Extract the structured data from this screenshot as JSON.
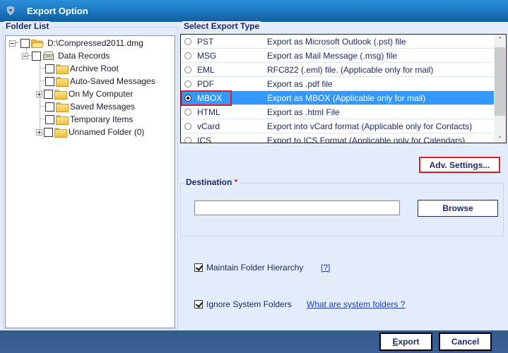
{
  "window": {
    "title": "Export Option",
    "icon": "app-logo-icon"
  },
  "folder_list": {
    "label": "Folder List",
    "tree": [
      {
        "label": "D:\\Compressed2011.dmg",
        "level": 0,
        "expander": "minus",
        "checked": false,
        "icon": "open-folder-icon"
      },
      {
        "label": "Data Records",
        "level": 1,
        "expander": "minus",
        "checked": false,
        "icon": "data-records-icon"
      },
      {
        "label": "Archive Root",
        "level": 2,
        "expander": null,
        "checked": false,
        "icon": "folder-icon"
      },
      {
        "label": "Auto-Saved Messages",
        "level": 2,
        "expander": null,
        "checked": false,
        "icon": "folder-icon"
      },
      {
        "label": "On My Computer",
        "level": 2,
        "expander": "plus",
        "checked": false,
        "icon": "folder-icon"
      },
      {
        "label": "Saved Messages",
        "level": 2,
        "expander": null,
        "checked": false,
        "icon": "folder-icon"
      },
      {
        "label": "Temporary Items",
        "level": 2,
        "expander": null,
        "checked": false,
        "icon": "folder-icon"
      },
      {
        "label": "Unnamed Folder (0)",
        "level": 2,
        "expander": "plus",
        "checked": false,
        "icon": "folder-icon"
      }
    ]
  },
  "export_type": {
    "label": "Select Export Type",
    "selected": "MBOX",
    "options": [
      {
        "name": "PST",
        "description": "Export as Microsoft Outlook (.pst) file"
      },
      {
        "name": "MSG",
        "description": "Export as Mail Message (.msg) file"
      },
      {
        "name": "EML",
        "description": "RFC822 (.eml) file. (Applicable only for mail)"
      },
      {
        "name": "PDF",
        "description": "Export as .pdf file"
      },
      {
        "name": "MBOX",
        "description": "Export as MBOX (Applicable only for mail)"
      },
      {
        "name": "HTML",
        "description": "Export as .html File"
      },
      {
        "name": "vCard",
        "description": "Export into vCard format (Applicable only for Contacts)"
      },
      {
        "name": "ICS",
        "description": "Export to ICS Format (Applicable only for Calendars)"
      }
    ]
  },
  "adv_settings_label": "Adv. Settings...",
  "destination": {
    "label": "Destination",
    "required_marker": "*",
    "value": "",
    "browse_label": "Browse"
  },
  "options": {
    "maintain_hierarchy": {
      "label": "Maintain Folder Hierarchy",
      "checked": true,
      "help_link": "[?]"
    },
    "ignore_system": {
      "label": "Ignore System Folders",
      "checked": true,
      "help_link": "What are system folders ?"
    }
  },
  "footer": {
    "export_label_accel": "E",
    "export_label_rest": "xport",
    "cancel_label": "Cancel"
  },
  "colors": {
    "title_bar": "#1d78c0",
    "selection": "#3399ff",
    "highlight_border": "#e21b2a",
    "footer": "#3b6196",
    "background": "#e3ecfa"
  }
}
